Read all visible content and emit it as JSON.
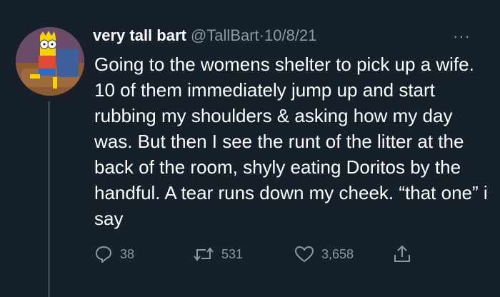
{
  "author": {
    "display_name": "very tall bart",
    "handle": "@TallBart",
    "separator": "·",
    "date": "10/8/21"
  },
  "tweet": {
    "text": "Going to the womens shelter to pick up a wife. 10 of them immediately jump up and start rubbing my shoulders & asking how my day was. But then I see the runt of the litter at the back of the room, shyly eating Doritos by the handful. A tear runs down my cheek. “that one” i say"
  },
  "more_label": "···",
  "actions": {
    "replies": "38",
    "retweets": "531",
    "likes": "3,658"
  },
  "colors": {
    "background": "#15202b",
    "text": "#ffffff",
    "secondary": "#8b98a5",
    "thread_line": "#38444d"
  },
  "icons": [
    "reply-icon",
    "retweet-icon",
    "like-icon",
    "share-icon",
    "more-icon"
  ]
}
